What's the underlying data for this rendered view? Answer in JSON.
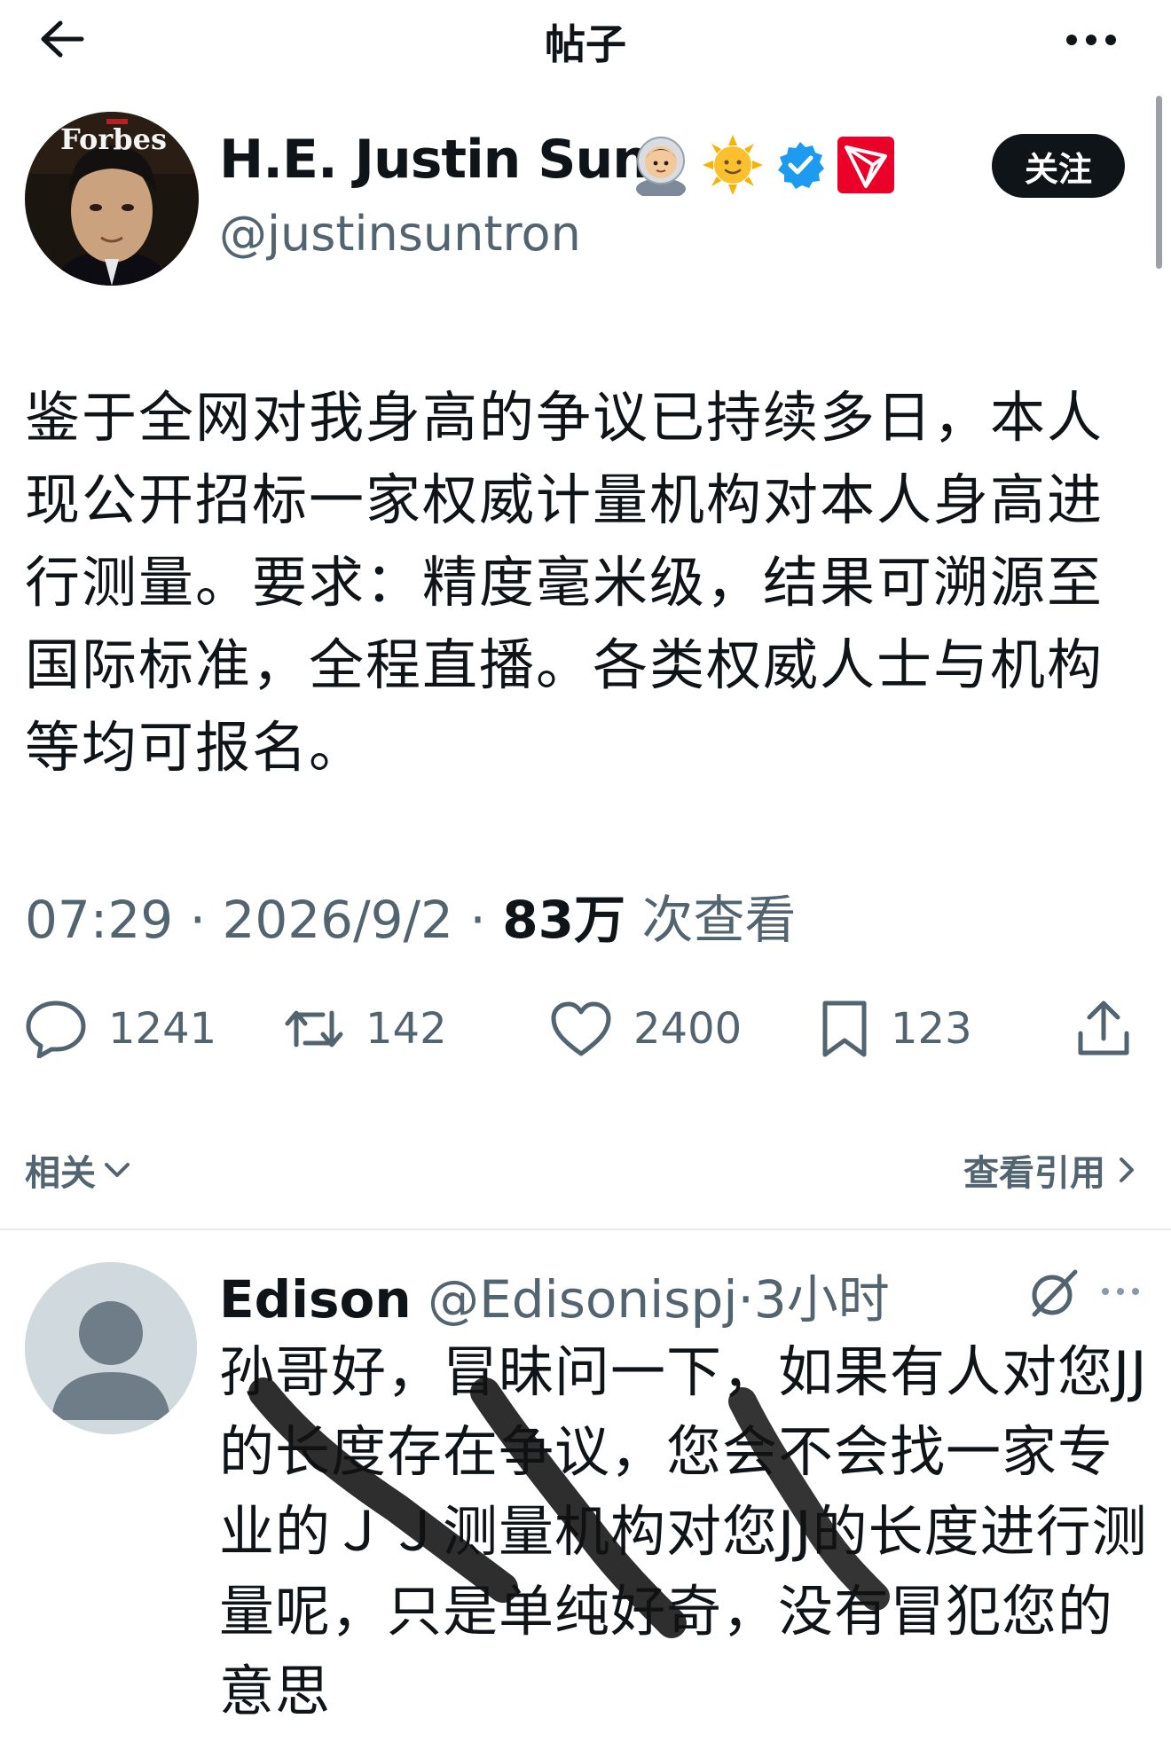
{
  "header": {
    "title": "帖子"
  },
  "author": {
    "name": "H.E. Justin Sun",
    "handle": "@justinsuntron",
    "avatar_text": "Forbes",
    "badges": [
      "astronaut-emoji",
      "sun-emoji",
      "verified-badge",
      "tron-logo"
    ],
    "follow_label": "关注"
  },
  "tweet": {
    "text": "鉴于全网对我身高的争议已持续多日，本人现公开招标一家权威计量机构对本人身高进行测量。要求：精度毫米级，结果可溯源至国际标准，全程直播。各类权威人士与机构等均可报名。",
    "time": "07:29",
    "date": "2026/9/2",
    "views_count": "83万",
    "views_label": "次查看",
    "sep": "·"
  },
  "actions": {
    "replies": "1241",
    "retweets": "142",
    "likes": "2400",
    "bookmarks": "123"
  },
  "related": {
    "label": "相关",
    "quotes_label": "查看引用"
  },
  "reply": {
    "name": "Edison",
    "handle": "@Edisonispj",
    "sep": "·",
    "time": "3小时",
    "text": "孙哥好，冒昧问一下，如果有人对您JJ的长度存在争议，您会不会找一家专业的ＪＪ测量机构对您JJ的长度进行测量呢，只是单纯好奇，没有冒犯您的意思"
  },
  "colors": {
    "text": "#0f1419",
    "secondary": "#536471",
    "verified": "#1d9bf0",
    "tron": "#eb0029"
  }
}
